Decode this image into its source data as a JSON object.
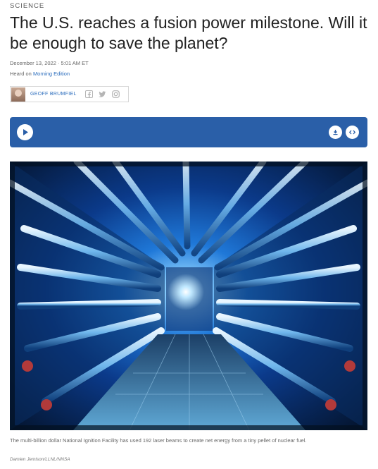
{
  "article": {
    "section": "SCIENCE",
    "headline": "The U.S. reaches a fusion power milestone. Will it be enough to save the planet?",
    "date": "December 13, 2022 · 5:01 AM ET",
    "heard_on_prefix": "Heard on ",
    "heard_on_program": "Morning Edition",
    "author": "GEOFF BRUMFIEL"
  },
  "social_icons": [
    "facebook-icon",
    "twitter-icon",
    "instagram-icon"
  ],
  "player": {
    "color": "#2a5fa8",
    "icons": [
      "play-icon",
      "download-icon",
      "embed-icon"
    ]
  },
  "figure": {
    "caption": "The multi-billion dollar National Ignition Facility has used 192 laser beams to create net energy from a tiny pellet of nuclear fuel.",
    "credit": "Damien Jemison/LLNL/NNSA"
  },
  "colors": {
    "link": "#2b6dbd",
    "player": "#2a5fa8",
    "photo_glow": "#4aa8ff"
  }
}
